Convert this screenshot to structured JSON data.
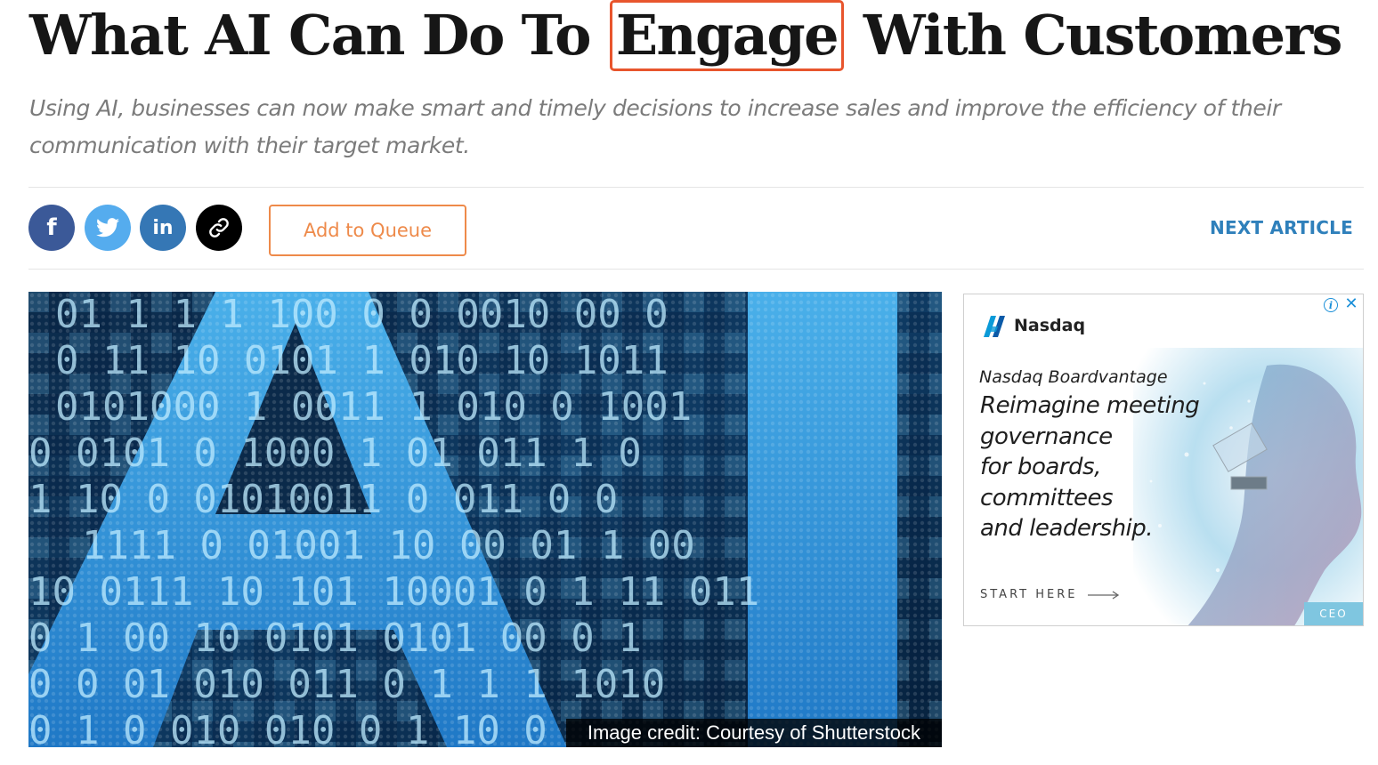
{
  "article": {
    "title_before": "What AI Can Do To",
    "title_highlight": "Engage",
    "title_after": "With Customers",
    "subtitle": "Using AI, businesses can now make smart and timely decisions to increase sales and improve the efficiency of their communication with their target market."
  },
  "share": {
    "facebook_glyph": "f",
    "linkedin_glyph": "in",
    "icons": [
      "facebook-icon",
      "twitter-icon",
      "linkedin-icon",
      "link-icon"
    ],
    "colors": {
      "facebook": "#3b5998",
      "twitter": "#55acee",
      "linkedin": "#3577b5",
      "link": "#000000"
    }
  },
  "toolbar": {
    "queue_label": "Add to Queue",
    "next_label": "NEXT ARTICLE"
  },
  "hero": {
    "big_text": "AI",
    "caption": "Image credit: Courtesy of Shutterstock"
  },
  "ad": {
    "brand": "Nasdaq",
    "subtitle": "Nasdaq Boardvantage",
    "headline": "Reimagine meeting\ngovernance\nfor boards,\ncommittees\nand leadership.",
    "cta": "START HERE",
    "tag": "CEO"
  },
  "colors": {
    "highlight_border": "#e8552d",
    "queue_accent": "#ee8a4a",
    "link_blue": "#2f80bb"
  }
}
